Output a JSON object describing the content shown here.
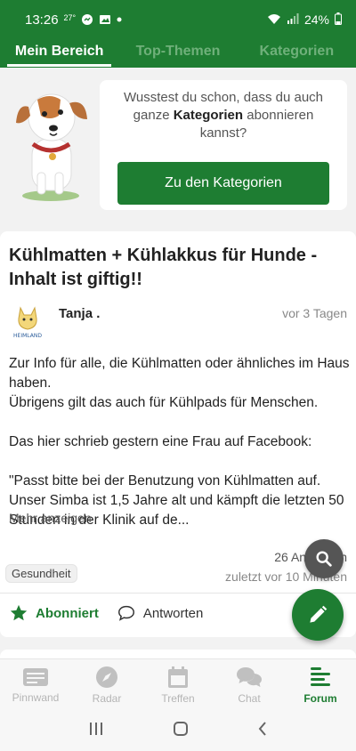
{
  "status_bar": {
    "time": "13:26",
    "temp": "27°",
    "battery": "24%"
  },
  "tabs": [
    {
      "label": "Mein Bereich",
      "active": true
    },
    {
      "label": "Top-Themen",
      "active": false
    },
    {
      "label": "Kategorien",
      "active": false
    }
  ],
  "promo": {
    "text_before": "Wusstest du schon, dass du auch ganze ",
    "text_bold": "Kategorien",
    "text_after": " abonnieren kannst?",
    "button_label": "Zu den Kategorien"
  },
  "post": {
    "title": "Kühlmatten + Kühlakkus für Hunde - Inhalt ist giftig!!",
    "author": "Tanja .",
    "time": "vor 3 Tagen",
    "avatar_text": "HEIMLAND",
    "body": [
      "Zur Info für alle, die Kühlmatten oder ähnliches im Haus haben.",
      "Übrigens gilt das auch für Kühlpads für Menschen.",
      "Das hier schrieb gestern eine Frau auf Facebook:",
      "\"Passt bitte bei der Benutzung von Kühlmatten auf. Unser Simba ist 1,5 Jahre alt und kämpft die letzten 50 Stunden in der Klinik auf de..."
    ],
    "more_label": "Mehr anzeigen",
    "replies": "26 Antworten",
    "last_reply": "zuletzt vor 10 Minuten",
    "tag": "Gesundheit",
    "subscribed_label": "Abonniert",
    "reply_label": "Antworten"
  },
  "bottom_nav": [
    {
      "label": "Pinnwand",
      "icon": "pinboard-icon",
      "active": false
    },
    {
      "label": "Radar",
      "icon": "compass-icon",
      "active": false
    },
    {
      "label": "Treffen",
      "icon": "calendar-icon",
      "active": false
    },
    {
      "label": "Chat",
      "icon": "chat-icon",
      "active": false
    },
    {
      "label": "Forum",
      "icon": "forum-icon",
      "active": true
    }
  ],
  "colors": {
    "brand": "#1e7d32",
    "fab_search": "#555555"
  }
}
